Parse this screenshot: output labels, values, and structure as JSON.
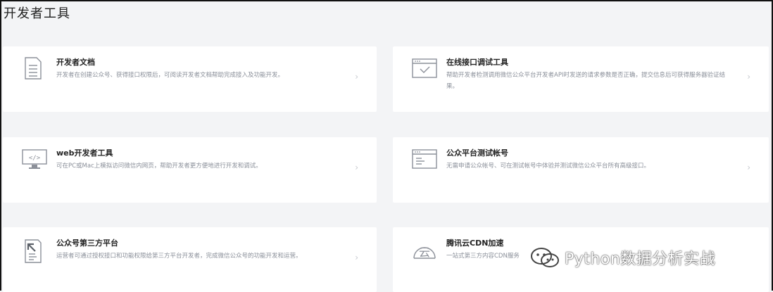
{
  "page": {
    "title": "开发者工具"
  },
  "cards": [
    {
      "title": "开发者文档",
      "desc": "开发者在创建公众号、获得接口权限后，可阅读开发者文档帮助完成接入及功能开发。",
      "icon": "document-icon"
    },
    {
      "title": "在线接口调试工具",
      "desc": "帮助开发者检测调用微信公众平台开发者API时发送的请求参数是否正确，提交信息后可获得服务器验证结果。",
      "icon": "window-check-icon"
    },
    {
      "title": "web开发者工具",
      "desc": "可在PC或Mac上模拟访问微信内网页，帮助开发者更方便地进行开发和调试。",
      "icon": "monitor-code-icon"
    },
    {
      "title": "公众平台测试帐号",
      "desc": "无需申请公众帐号、可在测试帐号中体验并测试微信公众平台所有高级接口。",
      "icon": "browser-window-icon"
    },
    {
      "title": "公众号第三方平台",
      "desc": "运营者可通过授权接口和功能权限给第三方平台开发者，完成微信公众号的功能开发和运营。",
      "icon": "document-arrow-icon"
    },
    {
      "title": "腾讯云CDN加速",
      "desc": "一站式第三方内容CDN服务",
      "icon": "cloud-yun-icon"
    }
  ],
  "chevron": "›",
  "watermark": {
    "text": "Python数据分析实战"
  }
}
